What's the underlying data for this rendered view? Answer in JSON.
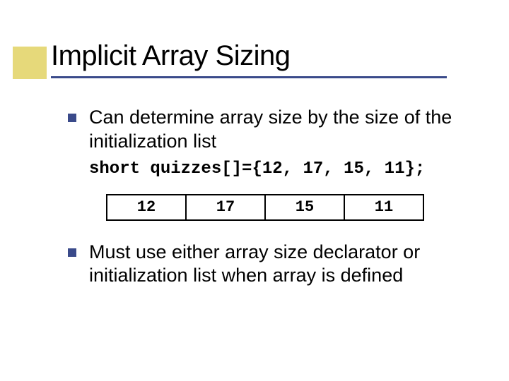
{
  "title": "Implicit Array Sizing",
  "bullets": [
    "Can determine array size by the size of the initialization list",
    "Must use either array size declarator or initialization list when array is defined"
  ],
  "code": "short quizzes[]={12, 17, 15, 11};",
  "array_cells": [
    "12",
    "17",
    "15",
    "11"
  ]
}
